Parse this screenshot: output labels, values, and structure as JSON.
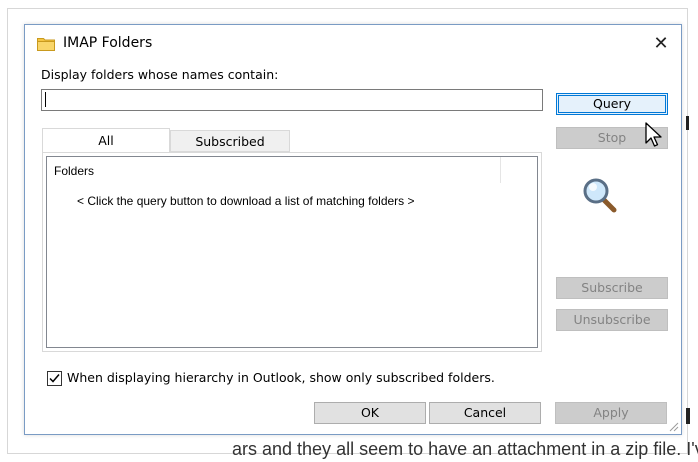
{
  "background": {
    "partial_text": "ars and they all seem to have an attachment in a zip file. I've never opened"
  },
  "dialog": {
    "title": "IMAP Folders",
    "close_glyph": "✕",
    "icon": "folder-icon",
    "prompt_label": "Display folders whose names contain:",
    "search": {
      "value": "",
      "placeholder": ""
    },
    "tabs": [
      {
        "label": "All",
        "selected": true
      },
      {
        "label": "Subscribed",
        "selected": false
      }
    ],
    "list": {
      "column_header": "Folders",
      "empty_message": "< Click the query button to download a list of matching folders >"
    },
    "buttons": {
      "query": "Query",
      "stop": "Stop",
      "subscribe": "Subscribe",
      "unsubscribe": "Unsubscribe",
      "ok": "OK",
      "cancel": "Cancel",
      "apply": "Apply"
    },
    "checkbox": {
      "label": "When displaying hierarchy in Outlook, show only subscribed folders.",
      "checked": true
    }
  },
  "colors": {
    "accent": "#0078d7",
    "disabled_bg": "#cccccc",
    "disabled_text": "#838383",
    "folder_yellow": "#f5c542"
  }
}
